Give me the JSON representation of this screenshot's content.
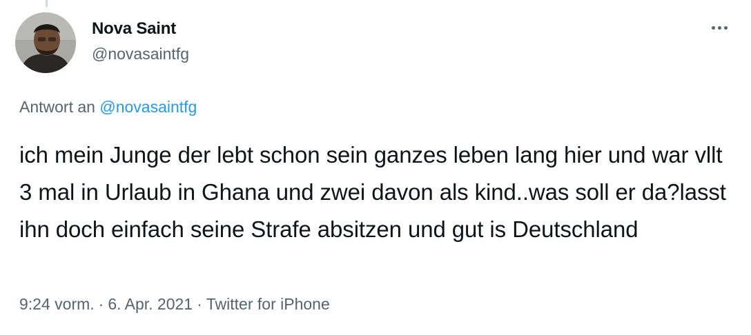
{
  "tweet": {
    "author": {
      "name": "Nova Saint",
      "handle": "@novasaintfg"
    },
    "reply": {
      "prefix": "Antwort an",
      "mention": "@novasaintfg"
    },
    "text": "ich mein Junge der lebt schon sein ganzes leben lang hier und war vllt 3 mal in Urlaub in Ghana und zwei davon als kind..was soll er da?lasst ihn doch einfach seine Strafe absitzen und gut is Deutschland",
    "meta": {
      "time": "9:24 vorm.",
      "separator": "·",
      "date": "6. Apr. 2021",
      "source": "Twitter for iPhone"
    }
  },
  "icons": {
    "more": "more-horizontal-icon",
    "avatar": "user-avatar"
  },
  "colors": {
    "text": "#0f1419",
    "secondary": "#536471",
    "link": "#1d9bf0",
    "thread_line": "#cfd9de"
  }
}
